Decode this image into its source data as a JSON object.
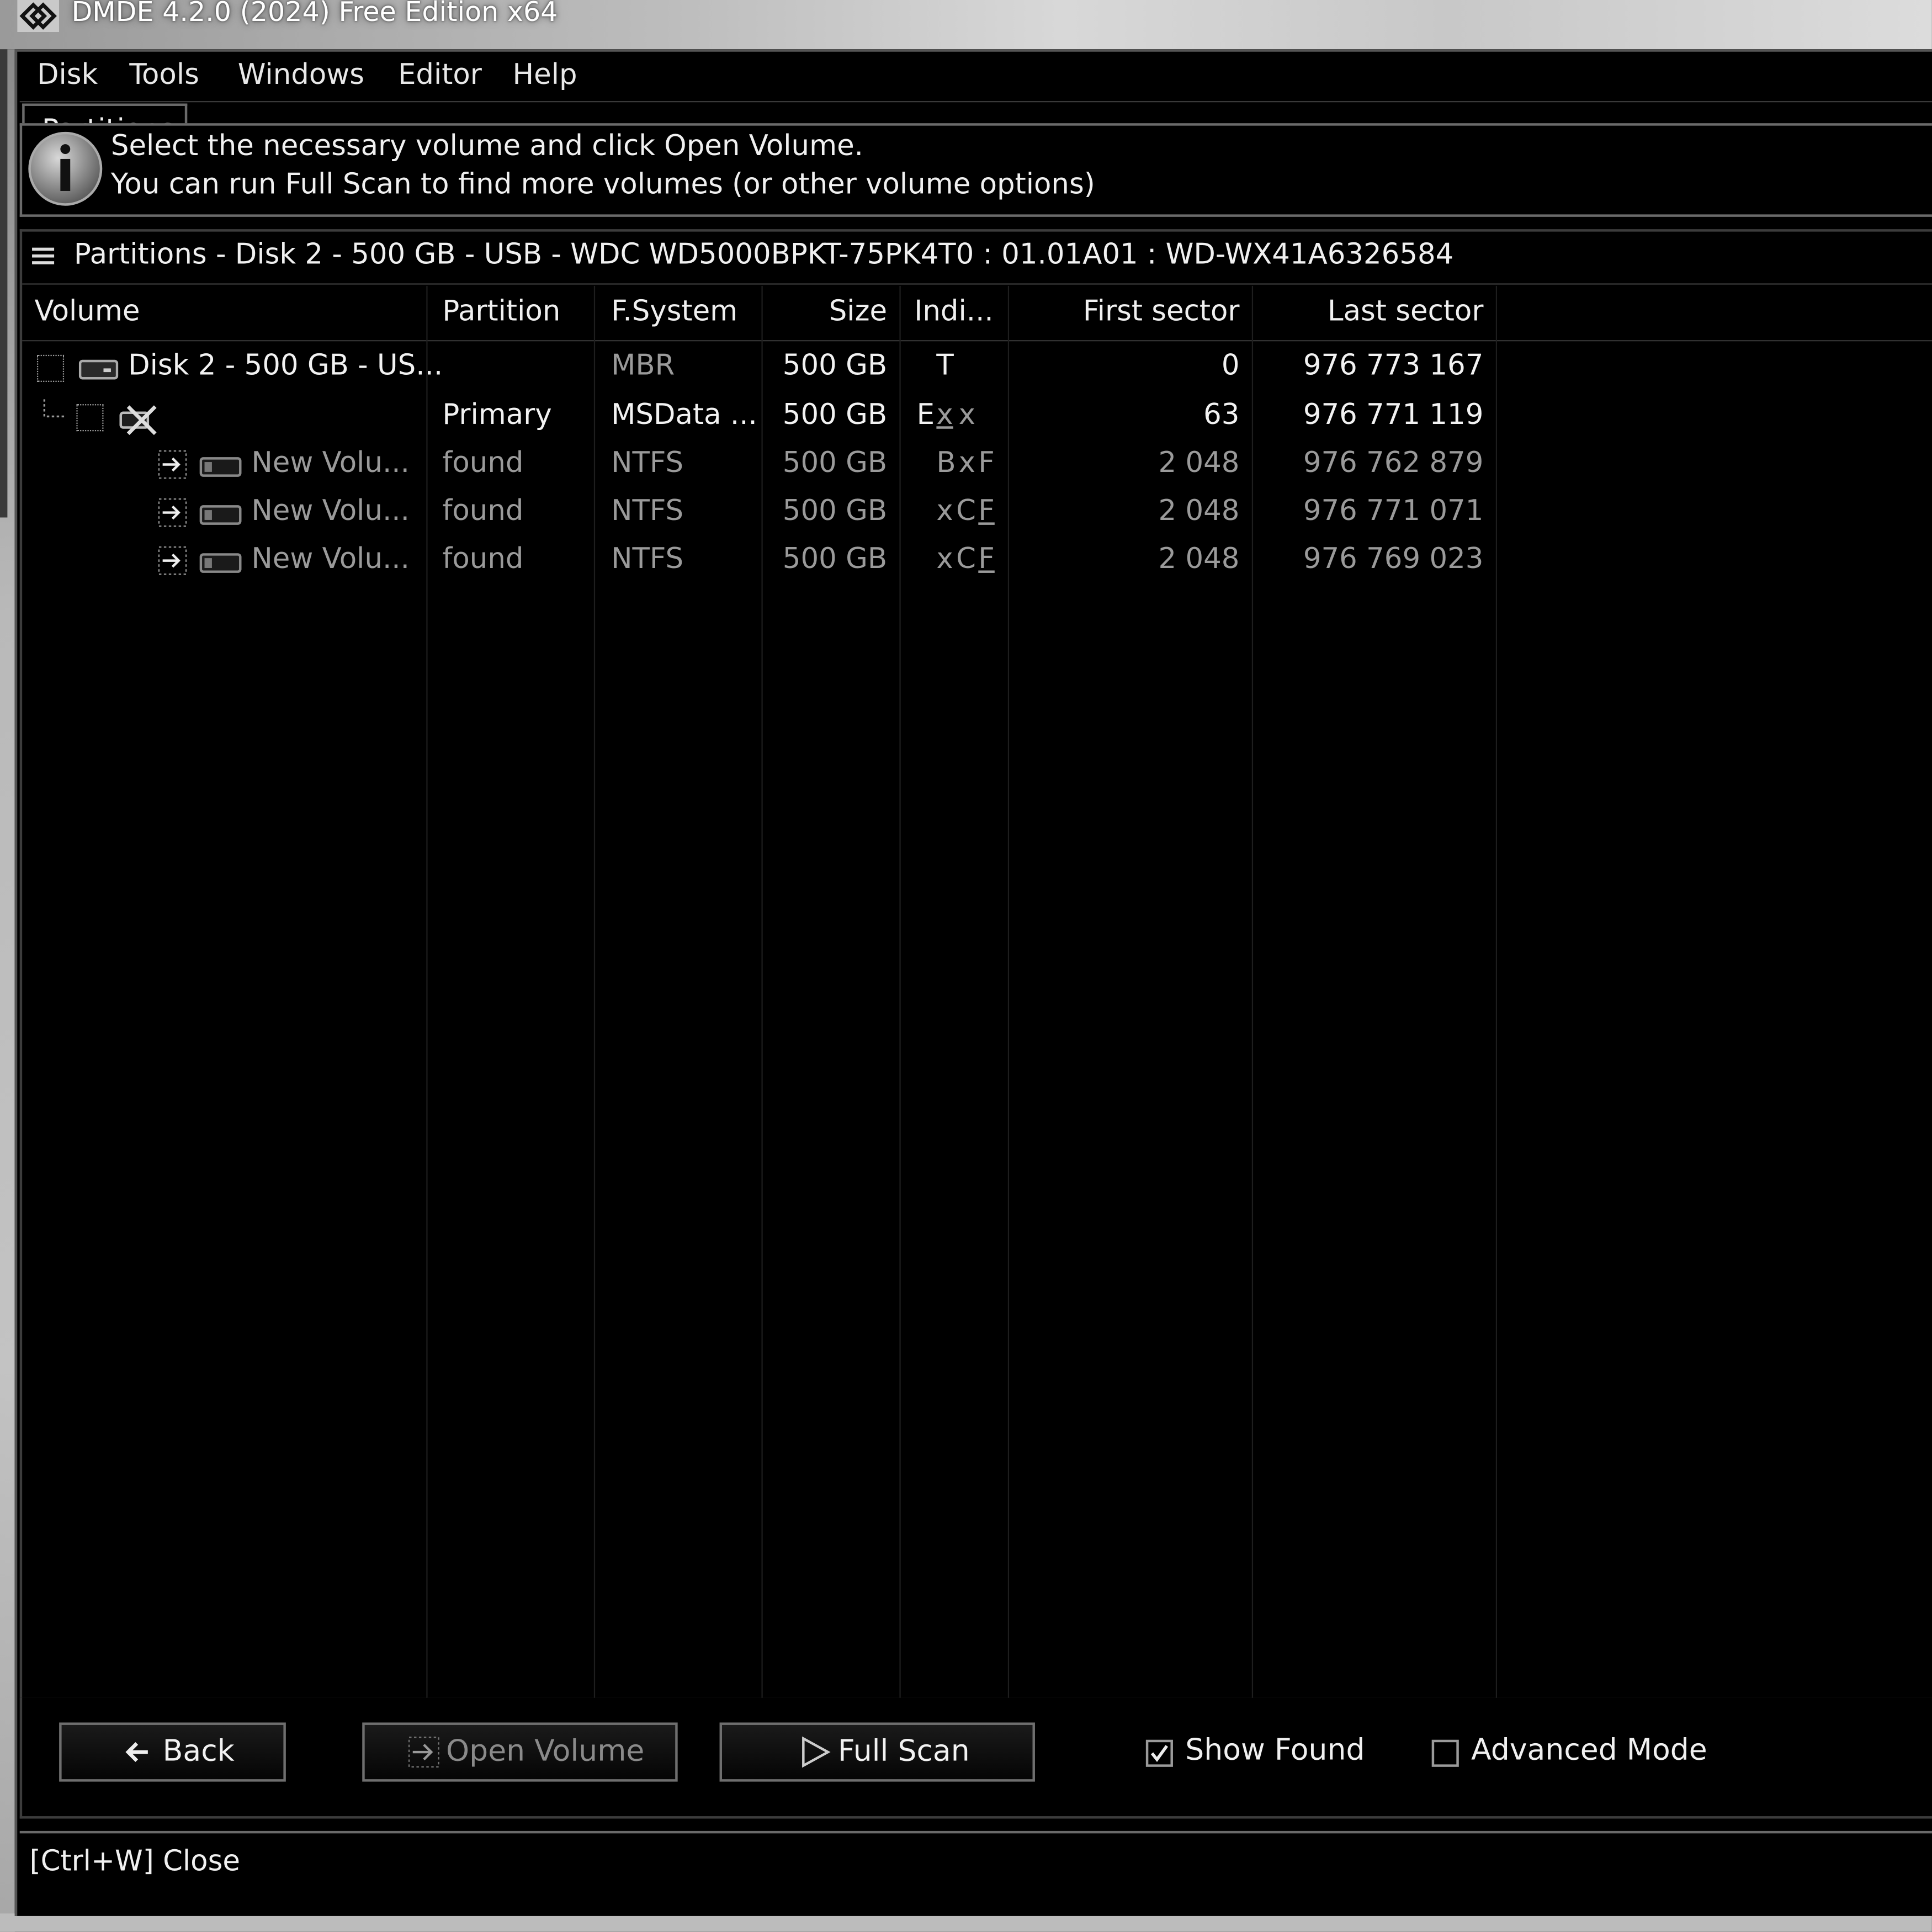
{
  "window": {
    "title": "DMDE 4.2.0 (2024) Free Edition x64"
  },
  "menu": {
    "items": [
      "Disk",
      "Tools",
      "Windows",
      "Editor",
      "Help"
    ]
  },
  "tabs": {
    "active": "Partitions"
  },
  "info": {
    "line1": "Select the necessary volume and click Open Volume.",
    "line2": "You can run Full Scan to find more volumes (or other volume options)",
    "icon": "info-icon"
  },
  "partitions_panel": {
    "title": "Partitions - Disk 2 - 500 GB - USB - WDC WD5000BPKT-75PK4T0 : 01.01A01 : WD-WX41A6326584",
    "columns": [
      "Volume",
      "Partition",
      "F.System",
      "Size",
      "Indi...",
      "First sector",
      "Last sector"
    ],
    "rows": [
      {
        "volume": "Disk 2 - 500 GB - US...",
        "partition": "",
        "fs": "MBR",
        "size": "500 GB",
        "ind_a": "T",
        "ind_b": "",
        "ind_c": "",
        "first": "0",
        "last": "976 773 167",
        "icon": "hard-disk-icon"
      },
      {
        "volume": "",
        "partition": "Primary",
        "fs": "MSData ...",
        "size": "500 GB",
        "ind_a": "E",
        "ind_b": "x",
        "ind_c": "x",
        "first": "63",
        "last": "976 771 119",
        "icon": "partition-error-icon"
      },
      {
        "volume": "New Volu...",
        "partition": "found",
        "fs": "NTFS",
        "size": "500 GB",
        "ind_a": "B",
        "ind_b": "x",
        "ind_c": "F",
        "first": "2 048",
        "last": "976 762 879",
        "icon": "volume-icon"
      },
      {
        "volume": "New Volu...",
        "partition": "found",
        "fs": "NTFS",
        "size": "500 GB",
        "ind_a": "x",
        "ind_b": "C",
        "ind_c": "F",
        "first": "2 048",
        "last": "976 771 071",
        "icon": "volume-icon"
      },
      {
        "volume": "New Volu...",
        "partition": "found",
        "fs": "NTFS",
        "size": "500 GB",
        "ind_a": "x",
        "ind_b": "C",
        "ind_c": "F",
        "first": "2 048",
        "last": "976 769 023",
        "icon": "volume-icon"
      }
    ]
  },
  "buttons": {
    "back": "Back",
    "open_volume": "Open Volume",
    "full_scan": "Full Scan"
  },
  "options": {
    "show_found_label": "Show Found",
    "show_found_checked": true,
    "advanced_mode_label": "Advanced Mode",
    "advanced_mode_checked": false
  },
  "status": {
    "text": "[Ctrl+W] Close"
  },
  "colors": {
    "background": "#000000",
    "text": "#f0f0f0",
    "dim_text": "#9a9a9a",
    "border": "#6a6a6a"
  }
}
